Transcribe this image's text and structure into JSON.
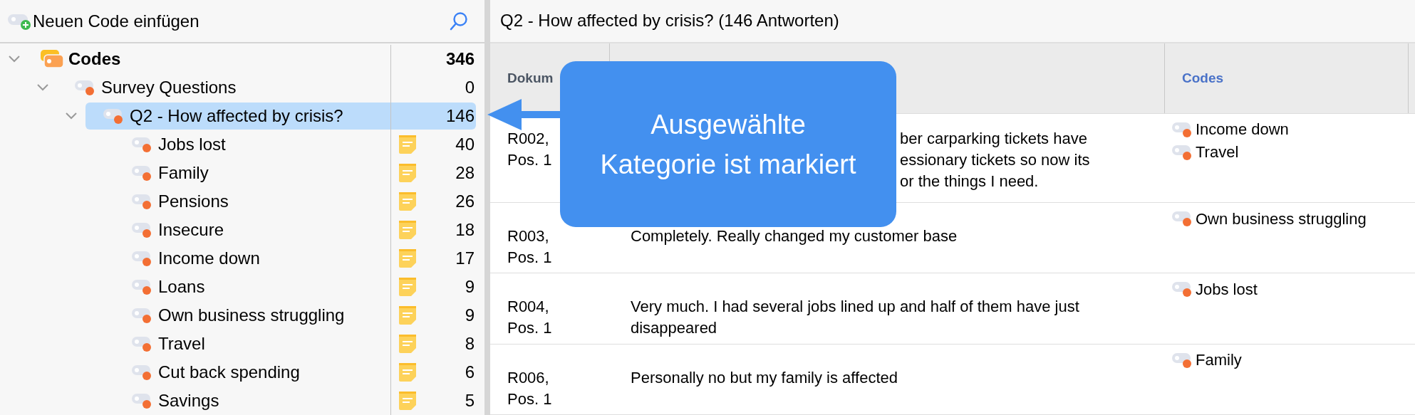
{
  "code_panel": {
    "new_code_label": "Neuen Code einfügen"
  },
  "code_tree": [
    {
      "name": "Codes",
      "count": "346",
      "kind": "root",
      "expanded": true,
      "selected": false,
      "children": [
        {
          "name": "Survey Questions",
          "count": "0",
          "kind": "code",
          "expanded": true,
          "selected": false,
          "children": [
            {
              "name": "Q2 - How affected by crisis?",
              "count": "146",
              "kind": "code",
              "expanded": true,
              "selected": true,
              "children": [
                {
                  "name": "Jobs lost",
                  "count": "40",
                  "kind": "code",
                  "selected": false,
                  "memo": true
                },
                {
                  "name": "Family",
                  "count": "28",
                  "kind": "code",
                  "selected": false,
                  "memo": true
                },
                {
                  "name": "Pensions",
                  "count": "26",
                  "kind": "code",
                  "selected": false,
                  "memo": true
                },
                {
                  "name": "Insecure",
                  "count": "18",
                  "kind": "code",
                  "selected": false,
                  "memo": true
                },
                {
                  "name": "Income down",
                  "count": "17",
                  "kind": "code",
                  "selected": false,
                  "memo": true
                },
                {
                  "name": "Loans",
                  "count": "9",
                  "kind": "code",
                  "selected": false,
                  "memo": true
                },
                {
                  "name": "Own business struggling",
                  "count": "9",
                  "kind": "code",
                  "selected": false,
                  "memo": true
                },
                {
                  "name": "Travel",
                  "count": "8",
                  "kind": "code",
                  "selected": false,
                  "memo": true
                },
                {
                  "name": "Cut back spending",
                  "count": "6",
                  "kind": "code",
                  "selected": false,
                  "memo": true
                },
                {
                  "name": "Savings",
                  "count": "5",
                  "kind": "code",
                  "selected": false,
                  "memo": true
                }
              ]
            }
          ]
        }
      ]
    }
  ],
  "results": {
    "title": "Q2 - How affected by crisis? (146 Antworten)",
    "columns": [
      {
        "label": "Dokum",
        "highlighted": false
      },
      {
        "label": "Codes",
        "highlighted": true
      }
    ],
    "rows": [
      {
        "document": "R002,\nPos. 1",
        "answer_fragments": [
          "ber carparking tickets have",
          "essionary tickets so now its",
          "or the things I need."
        ],
        "codes": [
          "Income down",
          "Travel"
        ]
      },
      {
        "document": "R003,\nPos. 1",
        "answer": "Completely. Really changed my customer base",
        "codes": [
          "Own business struggling"
        ]
      },
      {
        "document": "R004,\nPos. 1",
        "answer": "Very much. I had several jobs lined up and half of them have just disappeared",
        "codes": [
          "Jobs lost"
        ]
      },
      {
        "document": "R006,\nPos. 1",
        "answer": "Personally no but my family is affected",
        "codes": [
          "Family"
        ]
      }
    ]
  },
  "callout": {
    "text": "Ausgewählte\nKategorie ist markiert"
  }
}
